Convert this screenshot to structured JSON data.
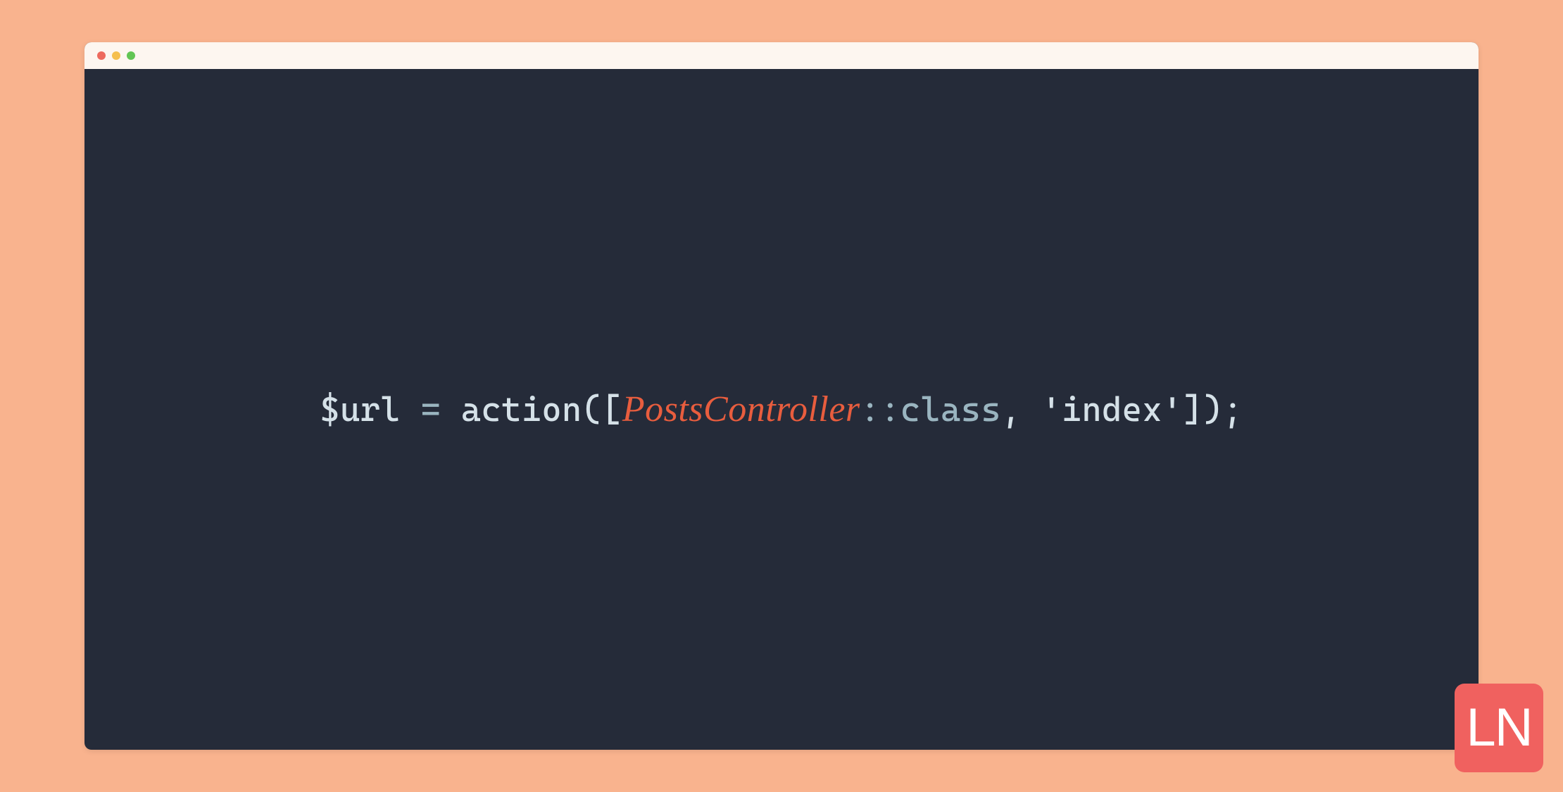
{
  "colors": {
    "background": "#f9b38e",
    "editor_bg": "#252b39",
    "titlebar_bg": "#fdf6f0",
    "traffic_red": "#ed6a5e",
    "traffic_yellow": "#f5bf4f",
    "traffic_green": "#62c554",
    "text_primary": "#d5e1e8",
    "text_secondary": "#9ab5c0",
    "accent_class": "#e85d3e",
    "badge_bg": "#f0615f"
  },
  "code": {
    "variable": "$url",
    "assign": " = ",
    "function": "action",
    "open_paren": "([",
    "class_name": "PostsController",
    "scope_op": "::",
    "class_keyword": "class",
    "comma": ", ",
    "string_literal": "'index'",
    "close_paren": "]);"
  },
  "logo": {
    "text": "LN"
  }
}
